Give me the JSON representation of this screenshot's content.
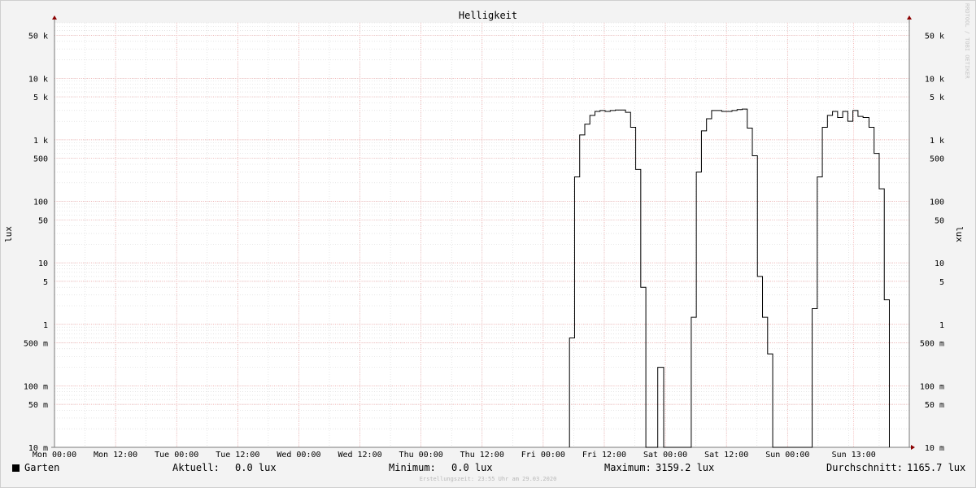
{
  "chart_data": {
    "type": "line",
    "title": "Helligkeit",
    "ylabel": "lux",
    "ylabel_right": "lux",
    "yscale": "log",
    "ylim": [
      0.01,
      80000
    ],
    "xlim": [
      "2020-03-23T00:00",
      "2020-03-29T23:55"
    ],
    "grid": true,
    "y_ticks": [
      {
        "value": 50000,
        "label": "50 k"
      },
      {
        "value": 10000,
        "label": "10 k"
      },
      {
        "value": 5000,
        "label": "5 k"
      },
      {
        "value": 1000,
        "label": "1 k"
      },
      {
        "value": 500,
        "label": "500"
      },
      {
        "value": 100,
        "label": "100"
      },
      {
        "value": 50,
        "label": "50"
      },
      {
        "value": 10,
        "label": "10"
      },
      {
        "value": 5,
        "label": "5"
      },
      {
        "value": 1,
        "label": "1"
      },
      {
        "value": 0.5,
        "label": "500 m"
      },
      {
        "value": 0.1,
        "label": "100 m"
      },
      {
        "value": 0.05,
        "label": "50 m"
      },
      {
        "value": 0.01,
        "label": "10 m"
      }
    ],
    "x_ticks": [
      {
        "value": "2020-03-23T00:00",
        "label": "Mon 00:00"
      },
      {
        "value": "2020-03-23T12:00",
        "label": "Mon 12:00"
      },
      {
        "value": "2020-03-24T00:00",
        "label": "Tue 00:00"
      },
      {
        "value": "2020-03-24T12:00",
        "label": "Tue 12:00"
      },
      {
        "value": "2020-03-25T00:00",
        "label": "Wed 00:00"
      },
      {
        "value": "2020-03-25T12:00",
        "label": "Wed 12:00"
      },
      {
        "value": "2020-03-26T00:00",
        "label": "Thu 00:00"
      },
      {
        "value": "2020-03-26T12:00",
        "label": "Thu 12:00"
      },
      {
        "value": "2020-03-27T00:00",
        "label": "Fri 00:00"
      },
      {
        "value": "2020-03-27T12:00",
        "label": "Fri 12:00"
      },
      {
        "value": "2020-03-28T00:00",
        "label": "Sat 00:00"
      },
      {
        "value": "2020-03-28T12:00",
        "label": "Sat 12:00"
      },
      {
        "value": "2020-03-29T00:00",
        "label": "Sun 00:00"
      },
      {
        "value": "2020-03-29T13:00",
        "label": "Sun 13:00"
      }
    ],
    "series": [
      {
        "name": "Garten",
        "color": "#000000",
        "points": [
          {
            "t": "2020-03-27T05:10",
            "v": 0.01
          },
          {
            "t": "2020-03-27T05:10",
            "v": 0.6
          },
          {
            "t": "2020-03-27T06:10",
            "v": 0.6
          },
          {
            "t": "2020-03-27T06:10",
            "v": 250
          },
          {
            "t": "2020-03-27T07:10",
            "v": 250
          },
          {
            "t": "2020-03-27T07:10",
            "v": 1200
          },
          {
            "t": "2020-03-27T08:10",
            "v": 1200
          },
          {
            "t": "2020-03-27T08:10",
            "v": 1800
          },
          {
            "t": "2020-03-27T09:10",
            "v": 1800
          },
          {
            "t": "2020-03-27T09:10",
            "v": 2500
          },
          {
            "t": "2020-03-27T10:10",
            "v": 2500
          },
          {
            "t": "2020-03-27T10:10",
            "v": 2900
          },
          {
            "t": "2020-03-27T11:10",
            "v": 2900
          },
          {
            "t": "2020-03-27T11:10",
            "v": 3000
          },
          {
            "t": "2020-03-27T12:10",
            "v": 3000
          },
          {
            "t": "2020-03-27T12:10",
            "v": 2900
          },
          {
            "t": "2020-03-27T13:10",
            "v": 2900
          },
          {
            "t": "2020-03-27T13:10",
            "v": 3000
          },
          {
            "t": "2020-03-27T14:10",
            "v": 3000
          },
          {
            "t": "2020-03-27T14:10",
            "v": 3050
          },
          {
            "t": "2020-03-27T16:10",
            "v": 3050
          },
          {
            "t": "2020-03-27T16:10",
            "v": 2800
          },
          {
            "t": "2020-03-27T17:10",
            "v": 2800
          },
          {
            "t": "2020-03-27T17:10",
            "v": 1600
          },
          {
            "t": "2020-03-27T18:10",
            "v": 1600
          },
          {
            "t": "2020-03-27T18:10",
            "v": 330
          },
          {
            "t": "2020-03-27T19:10",
            "v": 330
          },
          {
            "t": "2020-03-27T19:10",
            "v": 4
          },
          {
            "t": "2020-03-27T20:10",
            "v": 4
          },
          {
            "t": "2020-03-27T20:10",
            "v": 0.01
          },
          {
            "t": "2020-03-27T22:30",
            "v": 0.01
          },
          {
            "t": "2020-03-27T22:30",
            "v": 0.2
          },
          {
            "t": "2020-03-27T23:40",
            "v": 0.2
          },
          {
            "t": "2020-03-27T23:40",
            "v": 0.01
          },
          {
            "t": "2020-03-28T05:05",
            "v": 0.01
          },
          {
            "t": "2020-03-28T05:05",
            "v": 1.3
          },
          {
            "t": "2020-03-28T06:05",
            "v": 1.3
          },
          {
            "t": "2020-03-28T06:05",
            "v": 300
          },
          {
            "t": "2020-03-28T07:05",
            "v": 300
          },
          {
            "t": "2020-03-28T07:05",
            "v": 1400
          },
          {
            "t": "2020-03-28T08:05",
            "v": 1400
          },
          {
            "t": "2020-03-28T08:05",
            "v": 2200
          },
          {
            "t": "2020-03-28T09:05",
            "v": 2200
          },
          {
            "t": "2020-03-28T09:05",
            "v": 3000
          },
          {
            "t": "2020-03-28T11:05",
            "v": 3000
          },
          {
            "t": "2020-03-28T11:05",
            "v": 2900
          },
          {
            "t": "2020-03-28T13:05",
            "v": 2900
          },
          {
            "t": "2020-03-28T13:05",
            "v": 3000
          },
          {
            "t": "2020-03-28T14:05",
            "v": 3000
          },
          {
            "t": "2020-03-28T14:05",
            "v": 3100
          },
          {
            "t": "2020-03-28T15:05",
            "v": 3100
          },
          {
            "t": "2020-03-28T15:05",
            "v": 3159.2
          },
          {
            "t": "2020-03-28T16:05",
            "v": 3159.2
          },
          {
            "t": "2020-03-28T16:05",
            "v": 1550
          },
          {
            "t": "2020-03-28T17:05",
            "v": 1550
          },
          {
            "t": "2020-03-28T17:05",
            "v": 550
          },
          {
            "t": "2020-03-28T18:05",
            "v": 550
          },
          {
            "t": "2020-03-28T18:05",
            "v": 6
          },
          {
            "t": "2020-03-28T19:05",
            "v": 6
          },
          {
            "t": "2020-03-28T19:05",
            "v": 1.3
          },
          {
            "t": "2020-03-28T20:05",
            "v": 1.3
          },
          {
            "t": "2020-03-28T20:05",
            "v": 0.33
          },
          {
            "t": "2020-03-28T21:05",
            "v": 0.33
          },
          {
            "t": "2020-03-28T21:05",
            "v": 0.01
          },
          {
            "t": "2020-03-29T04:50",
            "v": 0.01
          },
          {
            "t": "2020-03-29T04:50",
            "v": 1.8
          },
          {
            "t": "2020-03-29T05:50",
            "v": 1.8
          },
          {
            "t": "2020-03-29T05:50",
            "v": 250
          },
          {
            "t": "2020-03-29T06:50",
            "v": 250
          },
          {
            "t": "2020-03-29T06:50",
            "v": 1600
          },
          {
            "t": "2020-03-29T07:50",
            "v": 1600
          },
          {
            "t": "2020-03-29T07:50",
            "v": 2500
          },
          {
            "t": "2020-03-29T08:50",
            "v": 2500
          },
          {
            "t": "2020-03-29T08:50",
            "v": 2900
          },
          {
            "t": "2020-03-29T09:50",
            "v": 2900
          },
          {
            "t": "2020-03-29T09:50",
            "v": 2300
          },
          {
            "t": "2020-03-29T10:50",
            "v": 2300
          },
          {
            "t": "2020-03-29T10:50",
            "v": 2900
          },
          {
            "t": "2020-03-29T11:50",
            "v": 2900
          },
          {
            "t": "2020-03-29T11:50",
            "v": 2000
          },
          {
            "t": "2020-03-29T12:50",
            "v": 2000
          },
          {
            "t": "2020-03-29T12:50",
            "v": 3000
          },
          {
            "t": "2020-03-29T13:50",
            "v": 3000
          },
          {
            "t": "2020-03-29T13:50",
            "v": 2400
          },
          {
            "t": "2020-03-29T14:50",
            "v": 2400
          },
          {
            "t": "2020-03-29T14:50",
            "v": 2300
          },
          {
            "t": "2020-03-29T16:00",
            "v": 2300
          },
          {
            "t": "2020-03-29T16:00",
            "v": 1600
          },
          {
            "t": "2020-03-29T17:00",
            "v": 1600
          },
          {
            "t": "2020-03-29T17:00",
            "v": 600
          },
          {
            "t": "2020-03-29T18:00",
            "v": 600
          },
          {
            "t": "2020-03-29T18:00",
            "v": 160
          },
          {
            "t": "2020-03-29T19:00",
            "v": 160
          },
          {
            "t": "2020-03-29T19:00",
            "v": 2.5
          },
          {
            "t": "2020-03-29T20:00",
            "v": 2.5
          },
          {
            "t": "2020-03-29T20:00",
            "v": 0.01
          }
        ]
      }
    ]
  },
  "watermark": "RRDTOOL / TOBI OETIKER",
  "legend": {
    "series_name": "Garten",
    "current_label": "Aktuell:",
    "current_value": "0.0 lux",
    "min_label": "Minimum:",
    "min_value": "0.0 lux",
    "max_label": "Maximum:",
    "max_value": "3159.2 lux",
    "avg_label": "Durchschnitt:",
    "avg_value": "1165.7 lux"
  },
  "created": "Erstellungszeit: 23:55 Uhr am 29.03.2020"
}
